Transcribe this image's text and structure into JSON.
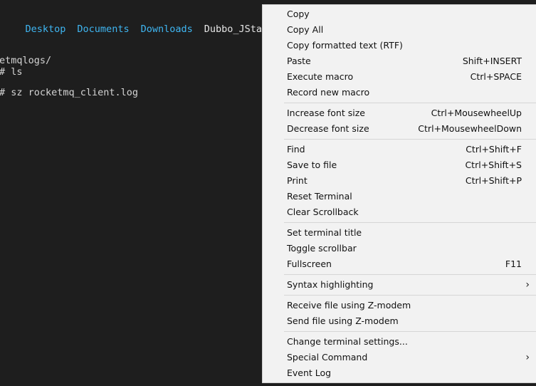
{
  "terminal": {
    "listing": [
      "Desktop",
      "Documents",
      "Downloads"
    ],
    "listing_file": "Dubbo_JStack.lo",
    "line_cd": "etmqlogs/",
    "line_ls": "# ls",
    "line_sz": "# sz rocketmq_client.log"
  },
  "menu": {
    "groups": [
      {
        "items": [
          {
            "label": "Copy",
            "shortcut": ""
          },
          {
            "label": "Copy All",
            "shortcut": ""
          },
          {
            "label": "Copy formatted text (RTF)",
            "shortcut": ""
          },
          {
            "label": "Paste",
            "shortcut": "Shift+INSERT"
          },
          {
            "label": "Execute macro",
            "shortcut": "Ctrl+SPACE"
          },
          {
            "label": "Record new macro",
            "shortcut": ""
          }
        ]
      },
      {
        "items": [
          {
            "label": "Increase font size",
            "shortcut": "Ctrl+MousewheelUp"
          },
          {
            "label": "Decrease font size",
            "shortcut": "Ctrl+MousewheelDown"
          }
        ]
      },
      {
        "items": [
          {
            "label": "Find",
            "shortcut": "Ctrl+Shift+F"
          },
          {
            "label": "Save to file",
            "shortcut": "Ctrl+Shift+S"
          },
          {
            "label": "Print",
            "shortcut": "Ctrl+Shift+P"
          },
          {
            "label": "Reset Terminal",
            "shortcut": ""
          },
          {
            "label": "Clear Scrollback",
            "shortcut": ""
          }
        ]
      },
      {
        "items": [
          {
            "label": "Set terminal title",
            "shortcut": ""
          },
          {
            "label": "Toggle scrollbar",
            "shortcut": ""
          },
          {
            "label": "Fullscreen",
            "shortcut": "F11"
          }
        ]
      },
      {
        "items": [
          {
            "label": "Syntax highlighting",
            "shortcut": "",
            "submenu": "›"
          }
        ]
      },
      {
        "items": [
          {
            "label": "Receive file using Z-modem",
            "shortcut": ""
          },
          {
            "label": "Send file using Z-modem",
            "shortcut": ""
          }
        ]
      },
      {
        "items": [
          {
            "label": "Change terminal settings...",
            "shortcut": ""
          },
          {
            "label": "Special Command",
            "shortcut": "",
            "submenu": "›"
          },
          {
            "label": "Event Log",
            "shortcut": ""
          }
        ]
      }
    ]
  }
}
